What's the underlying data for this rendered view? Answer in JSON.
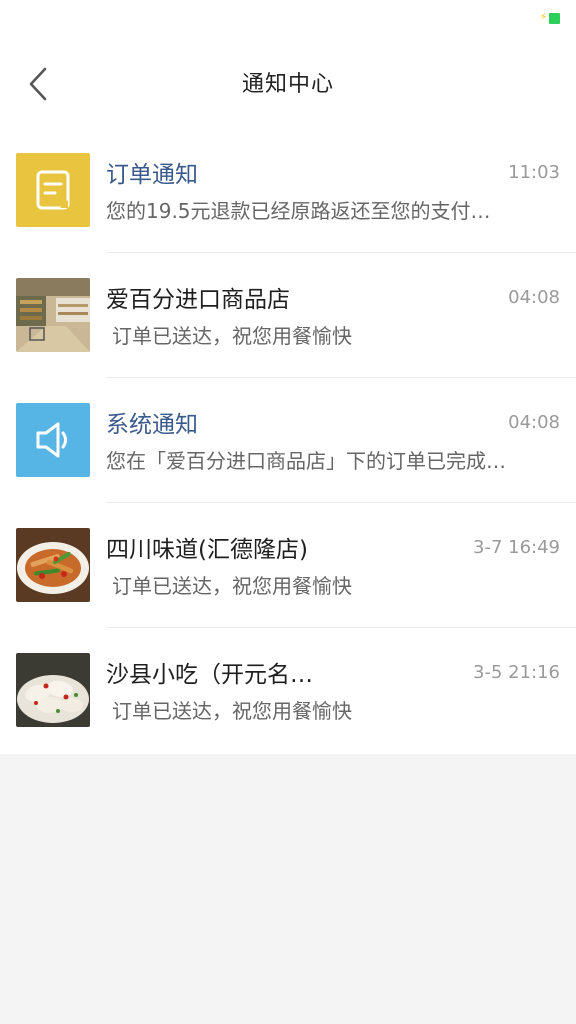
{
  "status_bar": {
    "battery_color": "#2bd05a",
    "charging_icon": "lightning-bolt-icon"
  },
  "header": {
    "title": "通知中心",
    "back_icon": "chevron-left-icon"
  },
  "colors": {
    "notice_title": "#3a5a8c",
    "order_icon_bg": "#e9c43f",
    "system_icon_bg": "#57b5e6",
    "time_text": "#9a9a9a"
  },
  "notifications": [
    {
      "title": "订单通知",
      "time": "11:03",
      "message": "您的19.5元退款已经原路返还至您的支付…",
      "icon": "order-note-icon",
      "kind": "system"
    },
    {
      "title": "爱百分进口商品店",
      "time": "04:08",
      "message": "订单已送达，祝您用餐愉快",
      "icon": "store-photo",
      "kind": "shop"
    },
    {
      "title": "系统通知",
      "time": "04:08",
      "message": "您在「爱百分进口商品店」下的订单已完成…",
      "icon": "speaker-icon",
      "kind": "system"
    },
    {
      "title": "四川味道(汇德隆店)",
      "time": "3-7 16:49",
      "message": "订单已送达，祝您用餐愉快",
      "icon": "food-photo",
      "kind": "shop"
    },
    {
      "title": "沙县小吃（开元名…",
      "time": "3-5 21:16",
      "message": "订单已送达，祝您用餐愉快",
      "icon": "dumpling-photo",
      "kind": "shop"
    }
  ]
}
